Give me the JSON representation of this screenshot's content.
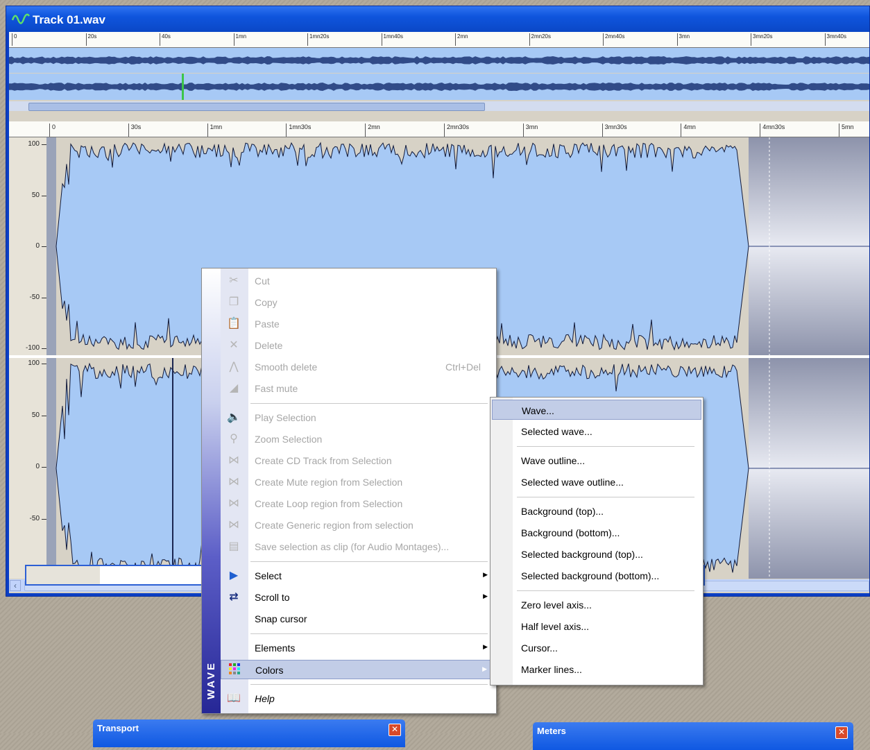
{
  "window": {
    "title": "Track 01.wav"
  },
  "overview_ruler": [
    "0",
    "20s",
    "40s",
    "1mn",
    "1mn20s",
    "1mn40s",
    "2mn",
    "2mn20s",
    "2mn40s",
    "3mn",
    "3mn20s",
    "3mn40s"
  ],
  "main_ruler": [
    "0",
    "30s",
    "1mn",
    "1mn30s",
    "2mn",
    "2mn30s",
    "3mn",
    "3mn30s",
    "4mn",
    "4mn30s",
    "5mn"
  ],
  "amplitude_labels": [
    "100",
    "50",
    "0",
    "-50",
    "-100"
  ],
  "context_menu": {
    "band_label": "WAVE",
    "items": [
      {
        "label": "Cut",
        "shortcut": "",
        "icon": "scissors-icon",
        "disabled": true
      },
      {
        "label": "Copy",
        "shortcut": "",
        "icon": "copy-icon",
        "disabled": true
      },
      {
        "label": "Paste",
        "shortcut": "",
        "icon": "paste-icon",
        "disabled": true
      },
      {
        "label": "Delete",
        "shortcut": "",
        "icon": "delete-icon",
        "disabled": true
      },
      {
        "label": "Smooth delete",
        "shortcut": "Ctrl+Del",
        "icon": "smooth-delete-icon",
        "disabled": true
      },
      {
        "label": "Fast mute",
        "shortcut": "",
        "icon": "fast-mute-icon",
        "disabled": true
      },
      {
        "label": "Play Selection",
        "shortcut": "",
        "icon": "speaker-icon",
        "disabled": true
      },
      {
        "label": "Zoom Selection",
        "shortcut": "",
        "icon": "zoom-icon",
        "disabled": true
      },
      {
        "label": "Create CD Track from Selection",
        "shortcut": "",
        "icon": "cd-track-icon",
        "disabled": true
      },
      {
        "label": "Create Mute region from Selection",
        "shortcut": "",
        "icon": "mute-region-icon",
        "disabled": true
      },
      {
        "label": "Create Loop region from Selection",
        "shortcut": "",
        "icon": "loop-region-icon",
        "disabled": true
      },
      {
        "label": "Create Generic region from selection",
        "shortcut": "",
        "icon": "generic-region-icon",
        "disabled": true
      },
      {
        "label": "Save selection as clip (for Audio Montages)...",
        "shortcut": "",
        "icon": "save-clip-icon",
        "disabled": true
      },
      {
        "label": "Select",
        "shortcut": "",
        "icon": "select-icon",
        "disabled": false
      },
      {
        "label": "Scroll to",
        "shortcut": "",
        "icon": "scroll-to-icon",
        "disabled": false
      },
      {
        "label": "Snap cursor",
        "shortcut": "",
        "icon": "",
        "disabled": false
      },
      {
        "label": "Elements",
        "shortcut": "",
        "icon": "",
        "disabled": false
      },
      {
        "label": "Colors",
        "shortcut": "",
        "icon": "palette-icon",
        "disabled": false
      },
      {
        "label": "Help",
        "shortcut": "",
        "icon": "help-book-icon",
        "disabled": false
      }
    ]
  },
  "colors_submenu": [
    "Wave...",
    "Selected wave...",
    "Wave outline...",
    "Selected wave outline...",
    "Background (top)...",
    "Background (bottom)...",
    "Selected background (top)...",
    "Selected background (bottom)...",
    "Zero level axis...",
    "Half level axis...",
    "Cursor...",
    "Marker lines..."
  ],
  "tool_windows": {
    "transport": "Transport",
    "meters": "Meters"
  },
  "colors": {
    "wave": "#a7c9f5",
    "wave_outline": "#10193a",
    "titlebar": "#0f55dd",
    "menu_highlight": "#c2cde7"
  }
}
